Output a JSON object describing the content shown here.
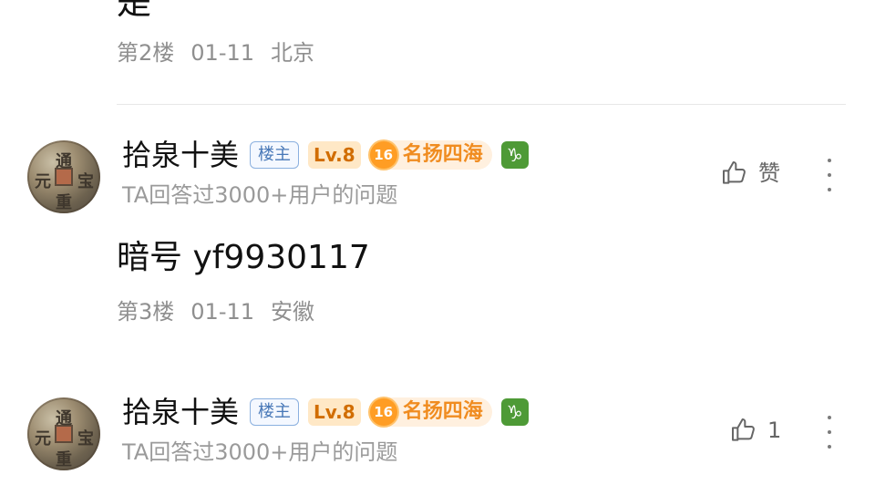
{
  "top_fragment": "是",
  "floor2_meta": {
    "floor": "第2楼",
    "date": "01-11",
    "location": "北京"
  },
  "comments": [
    {
      "username": "拾泉十美",
      "owner_badge": "楼主",
      "level_badge": "Lv.8",
      "honor_number": "16",
      "honor_text": "名扬四海",
      "zodiac_symbol": "♑",
      "subtitle": "TA回答过3000+用户的问题",
      "like_label": "赞",
      "content": "暗号 yf9930117",
      "meta": {
        "floor": "第3楼",
        "date": "01-11",
        "location": "安徽"
      }
    },
    {
      "username": "拾泉十美",
      "owner_badge": "楼主",
      "level_badge": "Lv.8",
      "honor_number": "16",
      "honor_text": "名扬四海",
      "zodiac_symbol": "♑",
      "subtitle": "TA回答过3000+用户的问题",
      "like_label": "1"
    }
  ],
  "icons": {
    "avatar": "coin-avatar-icon",
    "like": "thumbs-up-icon",
    "more": "more-vertical-icon"
  },
  "colors": {
    "owner_badge_border": "#8bb0df",
    "level_badge_bg": "#ffe8c6",
    "honor_bg": "#fff0df",
    "zodiac_bg": "#4e9a36"
  },
  "avatar_text": [
    "通",
    "宝",
    "重",
    "元"
  ]
}
